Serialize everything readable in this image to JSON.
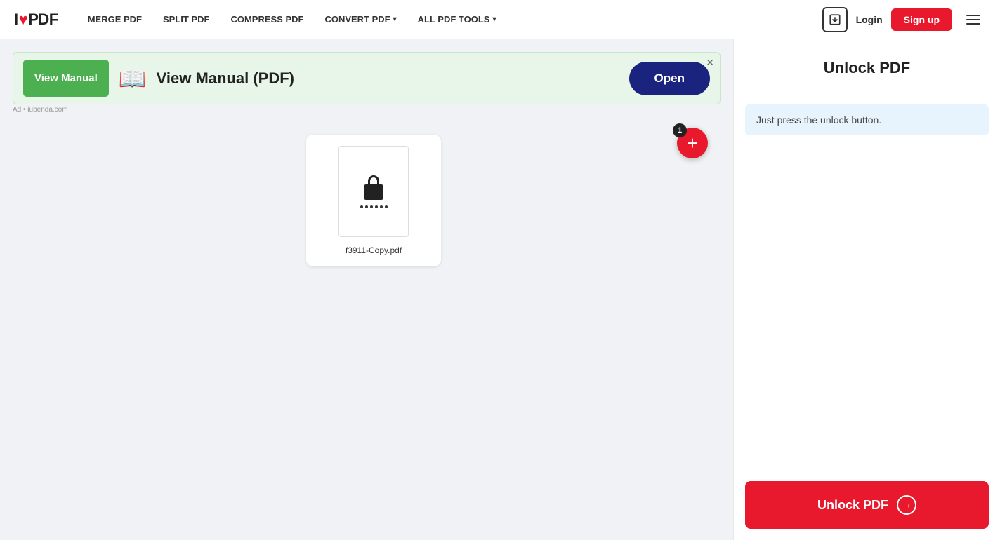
{
  "navbar": {
    "logo_i": "I",
    "logo_love": "♥",
    "logo_pdf": "PDF",
    "links": [
      {
        "id": "merge",
        "label": "MERGE PDF",
        "has_dropdown": false
      },
      {
        "id": "split",
        "label": "SPLIT PDF",
        "has_dropdown": false
      },
      {
        "id": "compress",
        "label": "COMPRESS PDF",
        "has_dropdown": false
      },
      {
        "id": "convert",
        "label": "CONVERT PDF",
        "has_dropdown": true
      },
      {
        "id": "all_tools",
        "label": "ALL PDF TOOLS",
        "has_dropdown": true
      }
    ],
    "login_label": "Login",
    "signup_label": "Sign up"
  },
  "ad": {
    "view_manual_btn": "View Manual",
    "icon": "📖",
    "text": "View Manual (PDF)",
    "open_btn": "Open"
  },
  "file": {
    "name": "f3911-Copy.pdf",
    "add_badge": "1"
  },
  "right_panel": {
    "title": "Unlock PDF",
    "info_text": "Just press the unlock button.",
    "unlock_btn_label": "Unlock PDF"
  }
}
